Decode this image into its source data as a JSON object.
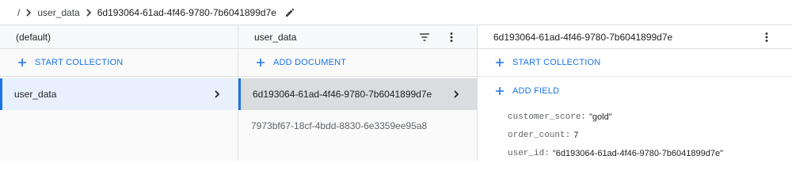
{
  "breadcrumb": {
    "root": "/",
    "collection": "user_data",
    "document": "6d193064-61ad-4f46-9780-7b6041899d7e"
  },
  "panel1": {
    "title": "(default)",
    "action": "START COLLECTION",
    "items": [
      {
        "label": "user_data"
      }
    ]
  },
  "panel2": {
    "title": "user_data",
    "action": "ADD DOCUMENT",
    "items": [
      {
        "label": "6d193064-61ad-4f46-9780-7b6041899d7e"
      },
      {
        "label": "7973bf67-18cf-4bdd-8830-6e3359ee95a8"
      }
    ]
  },
  "panel3": {
    "title": "6d193064-61ad-4f46-9780-7b6041899d7e",
    "action_collection": "START COLLECTION",
    "action_field": "ADD FIELD",
    "fields": [
      {
        "key": "customer_score:",
        "value": "\"gold\""
      },
      {
        "key": "order_count:",
        "value": "7"
      },
      {
        "key": "user_id:",
        "value": "\"6d193064-61ad-4f46-9780-7b6041899d7e\""
      }
    ]
  },
  "colors": {
    "accent": "#1a73e8",
    "selected_light": "#e8f0fe",
    "selected_dark": "#dadce0"
  },
  "icons": {
    "chevron": "chevron-right-icon",
    "edit": "pencil-icon",
    "filter": "filter-icon",
    "more": "more-vert-icon",
    "add": "plus-icon"
  }
}
